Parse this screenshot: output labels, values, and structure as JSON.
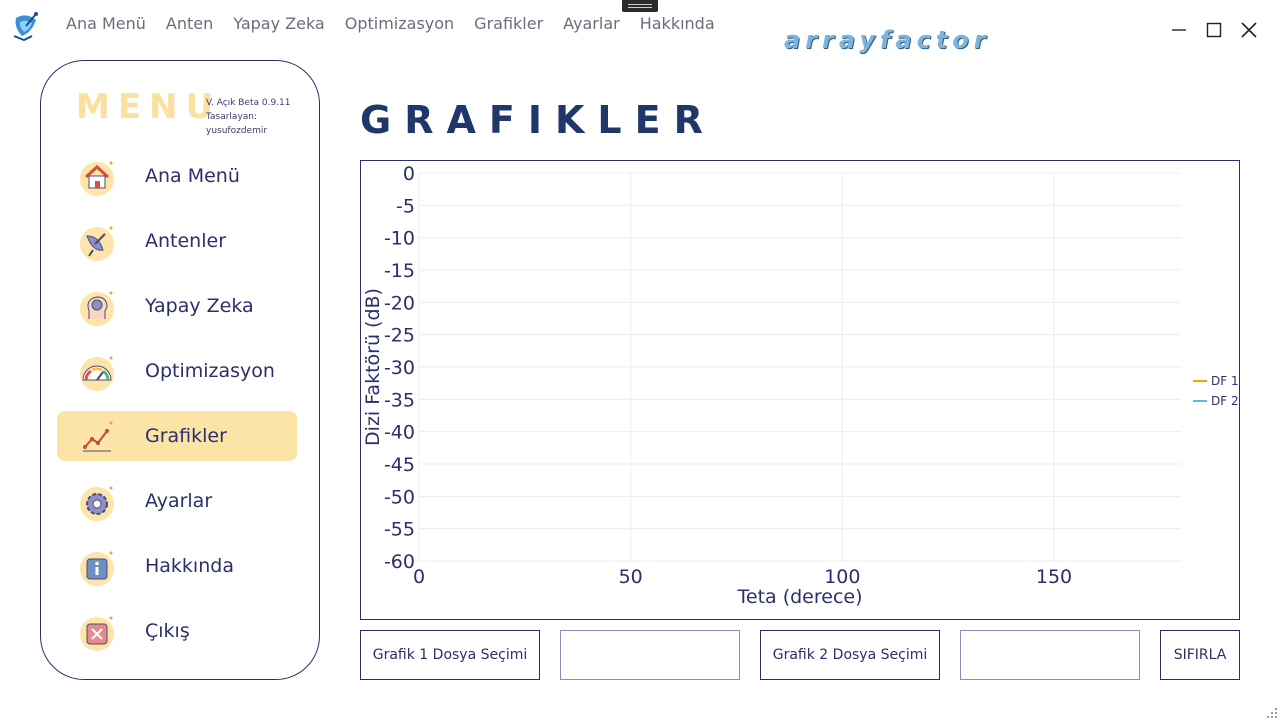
{
  "menubar": {
    "items": [
      "Ana Menü",
      "Anten",
      "Yapay Zeka",
      "Optimizasyon",
      "Grafikler",
      "Ayarlar",
      "Hakkında"
    ]
  },
  "logo": {
    "text": "arrayfactor"
  },
  "sidebar": {
    "title": "MENU",
    "version": "V. Açık Beta 0.9.11",
    "author": "Tasarlayan: yusufozdemir",
    "items": [
      {
        "label": "Ana Menü",
        "icon": "home-icon"
      },
      {
        "label": "Antenler",
        "icon": "satellite-dish-icon"
      },
      {
        "label": "Yapay Zeka",
        "icon": "brain-head-icon"
      },
      {
        "label": "Optimizasyon",
        "icon": "gauge-icon"
      },
      {
        "label": "Grafikler",
        "icon": "line-chart-icon",
        "active": true
      },
      {
        "label": "Ayarlar",
        "icon": "gear-icon"
      },
      {
        "label": "Hakkında",
        "icon": "info-icon"
      },
      {
        "label": "Çıkış",
        "icon": "exit-icon"
      }
    ]
  },
  "main": {
    "title": "GRAFIKLER",
    "buttons": {
      "file1": "Grafik 1 Dosya Seçimi",
      "file2": "Grafik 2 Dosya Seçimi",
      "reset": "SIFIRLA"
    },
    "file1_value": "",
    "file2_value": ""
  },
  "colors": {
    "accent": "#fce3a6",
    "navy": "#2b2f6b",
    "title": "#1f3769",
    "df1": "#f0a500",
    "df2": "#5fb8e8"
  },
  "chart_data": {
    "type": "line",
    "xlabel": "Teta (derece)",
    "ylabel": "Dizi Faktörü (dB)",
    "xlim": [
      0,
      180
    ],
    "ylim": [
      -60,
      0
    ],
    "xticks": [
      0,
      50,
      100,
      150
    ],
    "yticks": [
      0,
      -5,
      -10,
      -15,
      -20,
      -25,
      -30,
      -35,
      -40,
      -45,
      -50,
      -55,
      -60
    ],
    "grid": true,
    "legend_position": "right",
    "series": [
      {
        "name": "DF 1",
        "color": "#f0a500",
        "x": [],
        "y": []
      },
      {
        "name": "DF 2",
        "color": "#5fb8e8",
        "x": [],
        "y": []
      }
    ]
  }
}
